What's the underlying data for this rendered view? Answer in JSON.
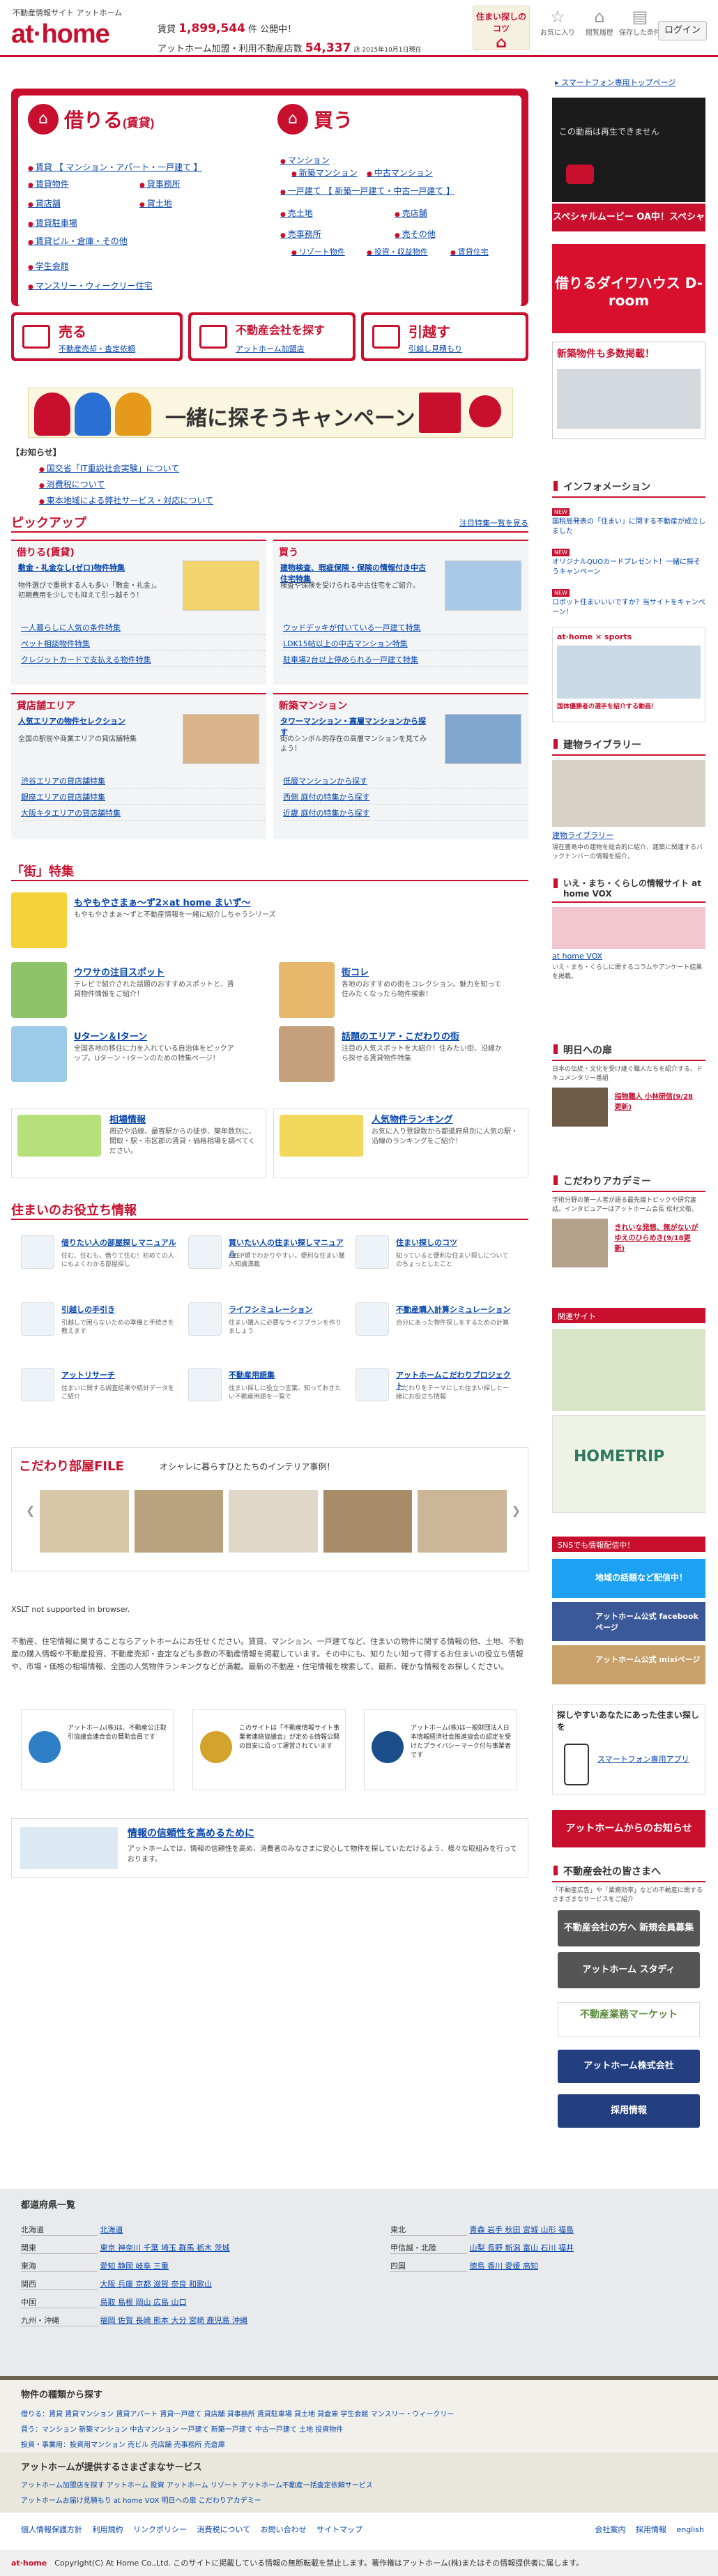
{
  "header": {
    "tagline": "不動産情報サイト アットホーム",
    "logo": "at·home",
    "stat1_label": "賃貸",
    "stat1_value": "1,899,544",
    "stat1_suffix": "件 公開中！",
    "stat2_label": "アットホーム加盟・利用不動産店数",
    "stat2_value": "54,337",
    "stat2_suffix": "店 2015年10月1日現在",
    "house_label": "住まい探しのコツ",
    "icons": [
      "お気に入り",
      "閲覧履歴",
      "保存した条件"
    ],
    "login": "ログイン"
  },
  "hire": {
    "title": "借りる",
    "sub": "(賃貸)",
    "links": [
      "賃貸 【 マンション・アパート・一戸建て 】",
      "賃貸物件",
      "貸店舗",
      "賃貸駐車場",
      "貸土地",
      "賃貸ビル・倉庫・その他",
      "学生会館",
      "マンスリー・ウィークリー住宅"
    ]
  },
  "buy": {
    "title": "買う",
    "links": [
      "マンション",
      "新築マンション",
      "中古マンション",
      "一戸建て 【 新築一戸建て・中古一戸建て 】",
      "売土地",
      "売店舗",
      "売事務所",
      "売その他",
      "リゾート物件",
      "投資・収益物件",
      "賃貸住宅"
    ]
  },
  "sell": {
    "title": "売る",
    "sub": "不動産売却・査定依頼"
  },
  "agency": {
    "title": "不動産会社を探す",
    "sub": "アットホーム加盟店"
  },
  "move": {
    "title": "引越す",
    "sub": "引越し見積もり"
  },
  "campaign": "一緒に探そうキャンペーン",
  "notice": {
    "title": "【お知らせ】",
    "items": [
      "国交省「IT重説社会実験」について",
      "消費税について",
      "東本地域による弊社サービス・対応について"
    ]
  },
  "pickup": {
    "title": "ピックアップ",
    "more": "注目特集一覧を見る",
    "hire_title": "借りる(賃貸)",
    "buy_title": "買う",
    "store_title": "貸店舗エリア",
    "new_title": "新築マンション",
    "hire_sub": "敷金・礼金なし(ゼロ)物件特集",
    "hire_desc": "物件選びで重視する人も多い「敷金・礼金」。初期費用を少しでも抑えて引っ越そう！",
    "buy_sub": "建物検査、瑕疵保険・保険の情報付き中古住宅特集",
    "buy_desc": "検査や保険を受けられる中古住宅をご紹介。",
    "store_sub": "人気エリアの物件セレクション",
    "store_desc": "全国の駅前や商業エリアの貸店舗特集",
    "new_sub": "タワーマンション・高層マンションから探す",
    "new_desc": "街のシンボル的存在の高層マンションを見てみよう！",
    "hire_links": [
      "一人暮らしに人気の条件特集",
      "ペット相談物件特集",
      "クレジットカードで支払える物件特集"
    ],
    "buy_links": [
      "ウッドデッキが付いている一戸建て特集",
      "LDK15帖以上の中古マンション特集",
      "駐車場2台以上停められる一戸建て特集"
    ],
    "store_links": [
      "渋谷エリアの貸店舗特集",
      "銀座エリアの貸店舗特集",
      "大阪キタエリアの貸店舗特集"
    ],
    "new_links": [
      "低層マンションから探す",
      "西側 庭付の特集から探す",
      "近畿 庭付の特集から探す"
    ]
  },
  "town": {
    "title": "「街」特集",
    "t1": "もやもやさまぁ～ず2×at home まいず～",
    "d1": "もやもやさまぁ～ずと不動産情報を一緒に紹介しちゃうシリーズ",
    "t2": "ウワサの注目スポット",
    "d2": "テレビで紹介された話題のおすすめスポットと、賃貸物件情報をご紹介！",
    "t3": "街コレ",
    "d3": "各地のおすすめの街をコレクション。魅力を知って住みたくなったら物件検索！",
    "t4": "Uターン＆Iターン",
    "d4": "全国各地の移住に力を入れている自治体をピックアップ。Uターン・Iターンのための特集ページ！",
    "t5": "話題のエリア・こだわりの街",
    "d5": "注目の人気スポットを大紹介！住みたい街、沿線から探せる賃貸物件特集",
    "t6": "相場情報",
    "d6": "周辺や沿線、最寄駅からの徒歩、築年数別に、間取・駅・市区郡の賃貸・価格相場を調べてください。",
    "t7": "人気物件ランキング",
    "d7": "お気に入り登録数から都道府県別に人気の駅・沿線のランキングをご紹介！"
  },
  "useful": {
    "title": "住まいのお役立ち情報",
    "items": [
      [
        "借りたい人の部屋探しマニュアル",
        "住む、住むも、借りて住む！初めての人にもよくわかる部屋探し"
      ],
      [
        "買いたい人の住まい探しマニュアル",
        "STEP順でわかりやすい。便利な住まい購入知識満載"
      ],
      [
        "住まい探しのコツ",
        "知っていると便利な住まい探しについてのちょっとしたこと"
      ],
      [
        "引越しの手引き",
        "引越しで困らないための準備と手続きを教えます"
      ],
      [
        "ライフシミュレーション",
        "住まい購入に必要なライフプランを作りましょう"
      ],
      [
        "不動産購入計算シミュレーション",
        "自分にあった物件探しをするための計算"
      ],
      [
        "アットリサーチ",
        "住まいに関する調査結果や統計データをご紹介"
      ],
      [
        "不動産用語集",
        "住まい探しに役立つ言葉、知っておきたい不動産用語を一覧で"
      ],
      [
        "アットホームこだわりプロジェクト",
        "こだわりをテーマにした住まい探しと一緒にお役立ち情報"
      ]
    ]
  },
  "kodawari": {
    "title": "こだわり部屋FILE",
    "sub": "オシャレに暮らすひとたちのインテリア事例！"
  },
  "xslt": "XSLT not supported in browser.",
  "about": "不動産、住宅情報に関することならアットホームにお任せください。賃貸、マンション、一戸建てなど、住まいの物件に関する情報の他、土地、不動産の購入情報や不動産投資、不動産売却・査定なども多数の不動産情報を掲載しています。その中にも、知りたい知って得するお住まいの役立ち情報や、市場・価格の相場情報、全国の人気物件ランキングなどが満載。最新の不動産・住宅情報を検索して、最新、確かな情報をお探しください。",
  "trust": [
    "アットホーム(株)は、不動産公正取引協議会連合会の賛助会員です",
    "このサイトは「不動産情報サイト事業者連絡協議会」が定める情報公開の目安に沿って運営されています",
    "アットホーム(株)は一般財団法人日本情報経済社会推進協会の認定を受けたプライバシーマーク付与事業者です"
  ],
  "reliability": {
    "title": "情報の信頼性を高めるために",
    "text": "アットホームでは、情報の信頼性を高め、消費者のみなさまに安心して物件を探していただけるよう、様々な取組みを行っております。"
  },
  "right": {
    "youtube_text": "この動画は再生できません",
    "special_banner": "スペシャルムービー OA中！スペシャルサイトへ",
    "droom": "借りるダイワハウス D-room",
    "new_banner": "新築物件も多数掲載！",
    "info_title": "インフォメーション",
    "info_items": [
      "国税局発表の「住まい」に関する不動産が成立しました",
      "オリジナルQUOカードプレゼント！一緒に探そうキャンペーン",
      "ロボット住まいいいですか？当サイトをキャンペーン！"
    ],
    "sports": "at·home × sports",
    "sports_link": "国体優勝者の選手を紹介する動画！",
    "library_title": "建物ライブラリー",
    "library_link": "建物ライブラリー",
    "library_text": "現在豊島中の建物を総合的に紹介、建築に関連するバックナンバーの情報を紹介。",
    "vox_title": "いえ・まち・くらしの情報サイト at home VOX",
    "vox_link": "at home VOX",
    "vox_text": "いえ・まち・くらしに関するコラムやアンケート結果を掲載。",
    "ashita_title": "明日への扉",
    "ashita_text": "日本の伝統・文化を受け継ぐ職人たちを紹介する、ドキュメンタリー番組",
    "ashita_link": "指物職人 小林研信(9/28更新)",
    "academy_title": "こだわりアカデミー",
    "academy_text": "学術分野の第一人者が語る最先端トピックや研究裏話。インタビュアーはアットホーム会長 松村文衛。",
    "academy_link": "きれいな発想、無がないがゆえのひらめき(9/18更新)",
    "related": "関連サイト",
    "sns": "SNSでも情報配信中！",
    "twitter": "地域の話題など配信中！",
    "facebook": "アットホーム公式 facebookページ",
    "mixi": "アットホーム公式 mixiページ",
    "app_title": "探しやすいあなたにあった住まい探しを",
    "app_text": "スマートフォン専用アプリ",
    "company_btn": "アットホームからのお知らせ",
    "pro_title": "不動産会社の皆さまへ",
    "pro_text": "「不動産広告」や「業務効率」などの不動産に関するさまざまなサービスをご紹介",
    "btn1": "不動産会社の方へ 新規会員募集",
    "btn2": "アットホーム スタディ",
    "reports": "不動産業務マーケット",
    "corp": "アットホーム株式会社",
    "recruit": "採用情報"
  },
  "pref": {
    "title": "都道府県一覧",
    "rows": [
      [
        "北海道",
        "北海道"
      ],
      [
        "関東",
        "東京 神奈川 千葉 埼玉 群馬 栃木 茨城"
      ],
      [
        "東北",
        "青森 岩手 秋田 宮城 山形 福島"
      ],
      [
        "甲信越・北陸",
        "山梨 長野 新潟 富山 石川 福井"
      ],
      [
        "東海",
        "愛知 静岡 岐阜 三重"
      ],
      [
        "関西",
        "大阪 兵庫 京都 滋賀 奈良 和歌山"
      ],
      [
        "中国",
        "鳥取 島根 岡山 広島 山口"
      ],
      [
        "四国",
        "徳島 香川 愛媛 高知"
      ],
      [
        "九州・沖縄",
        "福岡 佐賀 長崎 熊本 大分 宮崎 鹿児島 沖縄"
      ]
    ]
  },
  "kinds": {
    "title": "物件の種類から探す",
    "r1": "借りる：賃貸 賃貸マンション 賃貸アパート 賃貸一戸建て 貸店舗 貸事務所 賃貸駐車場 貸土地 貸倉庫 学生会館 マンスリー・ウィークリー",
    "r2": "買う：マンション 新築マンション 中古マンション 一戸建て 新築一戸建て 中古一戸建て 土地 投資物件",
    "r3": "投資・事業用：投資用マンション 売ビル 売店舗 売事務所 売倉庫"
  },
  "service": {
    "title": "アットホームが提供するさまざまなサービス",
    "r1": "アットホーム加盟店を探す アットホーム 投資 アットホーム リゾート アットホーム不動産一括査定依頼サービス",
    "r2": "アットホームお届け見積もり at home VOX 明日への扉 こだわりアカデミー"
  },
  "footer_links": [
    "個人情報保護方針",
    "利用規約",
    "リンクポリシー",
    "消費税について",
    "お問い合わせ",
    "サイトマップ"
  ],
  "footer_right": [
    "会社案内",
    "採用情報",
    "english"
  ],
  "copyright": "Copyright(C) At Home Co.,Ltd. このサイトに掲載している情報の無断転載を禁止します。著作権はアットホーム(株)またはその情報提供者に属します。"
}
